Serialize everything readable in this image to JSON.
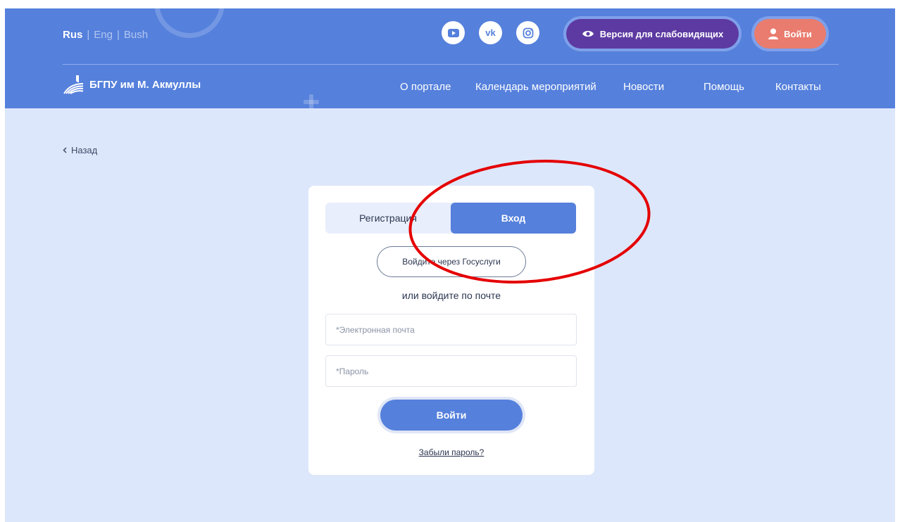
{
  "header": {
    "languages": [
      "Rus",
      "Eng",
      "Bush"
    ],
    "separator": "|",
    "social": [
      "youtube-icon",
      "vk-icon",
      "instagram-icon"
    ],
    "vk_text": "vk",
    "vision_label": "Версия для слабовидящих",
    "login_label": "Войти",
    "logo_text": "БГПУ им М. Акмуллы",
    "nav": [
      "О портале",
      "Календарь мероприятий",
      "Новости",
      "Помощь",
      "Контакты"
    ]
  },
  "back_label": "Назад",
  "form": {
    "tabs": [
      "Регистрация",
      "Вход"
    ],
    "active_tab": "Вход",
    "gosuslugi_label": "Войдите через Госуслуги",
    "or_text": "или войдите по почте",
    "email_placeholder": "*Электронная почта",
    "password_placeholder": "*Пароль",
    "submit_label": "Войти",
    "forgot_label": "Забыли пароль?"
  },
  "colors": {
    "header_bg": "#5580dc",
    "page_bg": "#dde7fb",
    "vision_btn": "#5d3aa2",
    "login_btn": "#e97c6e",
    "annotation": "#e50000"
  }
}
